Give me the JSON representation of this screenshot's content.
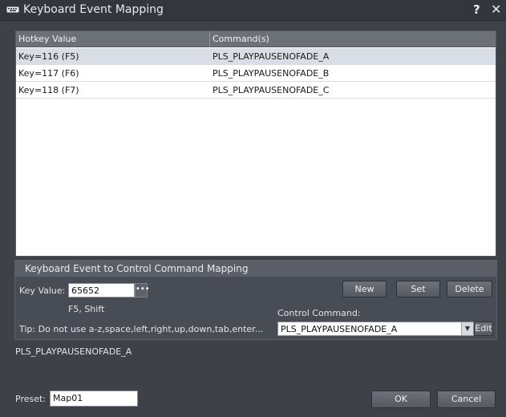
{
  "window": {
    "title": "Keyboard Event Mapping",
    "help_glyph": "?",
    "close_glyph": "✕",
    "icon": "keyboard-icon"
  },
  "table": {
    "headers": [
      "Hotkey Value",
      "Command(s)"
    ],
    "rows": [
      {
        "hotkey": "Key=116 (F5)",
        "command": "PLS_PLAYPAUSENOFADE_A",
        "selected": true
      },
      {
        "hotkey": "Key=117 (F6)",
        "command": "PLS_PLAYPAUSENOFADE_B",
        "selected": false
      },
      {
        "hotkey": "Key=118 (F7)",
        "command": "PLS_PLAYPAUSENOFADE_C",
        "selected": false
      }
    ]
  },
  "mapping": {
    "title": "Keyboard Event to Control Command Mapping",
    "key_value_label": "Key Value:",
    "key_value": "65652",
    "browse_label": "•••",
    "key_description": "F5, Shift",
    "new_label": "New",
    "set_label": "Set",
    "delete_label": "Delete",
    "control_command_label": "Control Command:",
    "control_command_value": "PLS_PLAYPAUSENOFADE_A",
    "dropdown_arrow": "▼",
    "edit_label": "Edit",
    "tip": "Tip: Do not use a-z,space,left,right,up,down,tab,enter..."
  },
  "selected_command_text": "PLS_PLAYPAUSENOFADE_A",
  "footer": {
    "preset_label": "Preset:",
    "preset_value": "Map01",
    "ok_label": "OK",
    "cancel_label": "Cancel"
  },
  "colors": {
    "background": "#3e4148",
    "titlebar": "#33363c",
    "header": "#6b7079",
    "selected_row": "#d9dde6"
  }
}
